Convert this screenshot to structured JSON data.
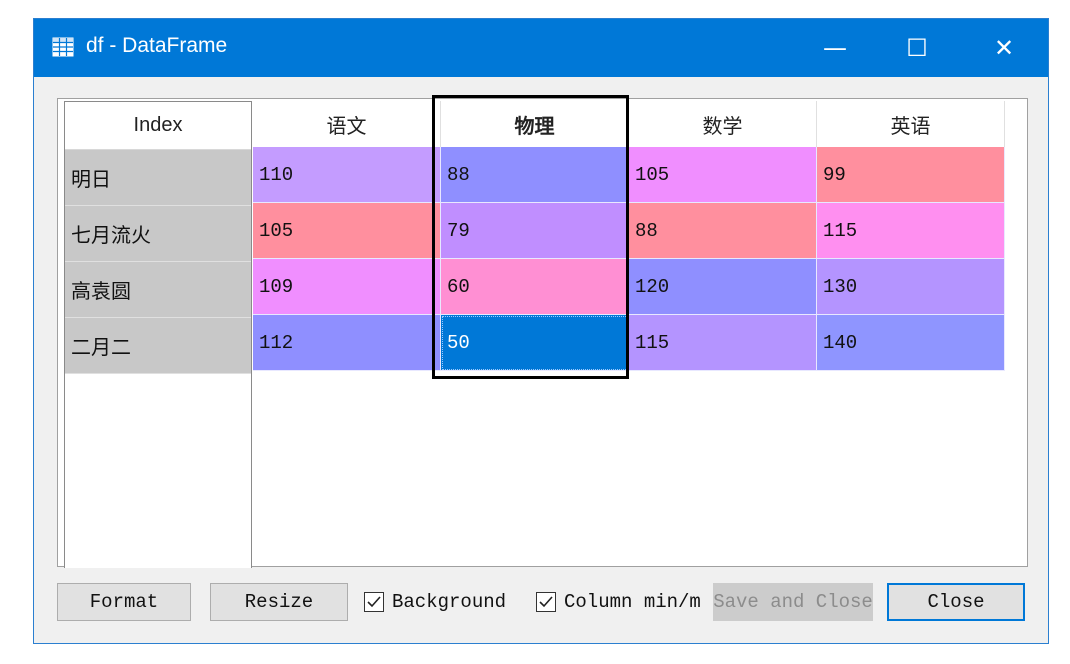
{
  "window": {
    "title": "df - DataFrame",
    "icon": "table-icon",
    "controls": {
      "minimize": "—",
      "maximize": "☐",
      "close": "✕"
    }
  },
  "table": {
    "index_header": "Index",
    "columns": [
      "语文",
      "物理",
      "数学",
      "英语"
    ],
    "index": [
      "明日",
      "七月流火",
      "高袁圆",
      "二月二"
    ],
    "rows": [
      [
        "110",
        "88",
        "105",
        "99"
      ],
      [
        "105",
        "79",
        "88",
        "115"
      ],
      [
        "109",
        "60",
        "120",
        "130"
      ],
      [
        "112",
        "50",
        "115",
        "140"
      ]
    ],
    "selected_cell": {
      "row": 3,
      "col": 1
    },
    "highlighted_column": "物理"
  },
  "colors": {
    "titlebar": "#0078d7",
    "selected_cell": "#0078d7",
    "cells": [
      [
        "#c49cff",
        "#8f8fff",
        "#f08eff",
        "#ff8f9e"
      ],
      [
        "#ff8f9e",
        "#c08eff",
        "#ff8f9e",
        "#ff8ff0"
      ],
      [
        "#f08eff",
        "#ff8fd3",
        "#8f8fff",
        "#b494ff"
      ],
      [
        "#8f8fff",
        "#0078d7",
        "#b494ff",
        "#8f95ff"
      ]
    ]
  },
  "buttons": {
    "format": "Format",
    "resize": "Resize",
    "save_and_close": "Save and Close",
    "close": "Close"
  },
  "checkboxes": {
    "background": {
      "label": "Background",
      "checked": true
    },
    "column_minmax": {
      "label": "Column min/max",
      "checked": true
    }
  }
}
